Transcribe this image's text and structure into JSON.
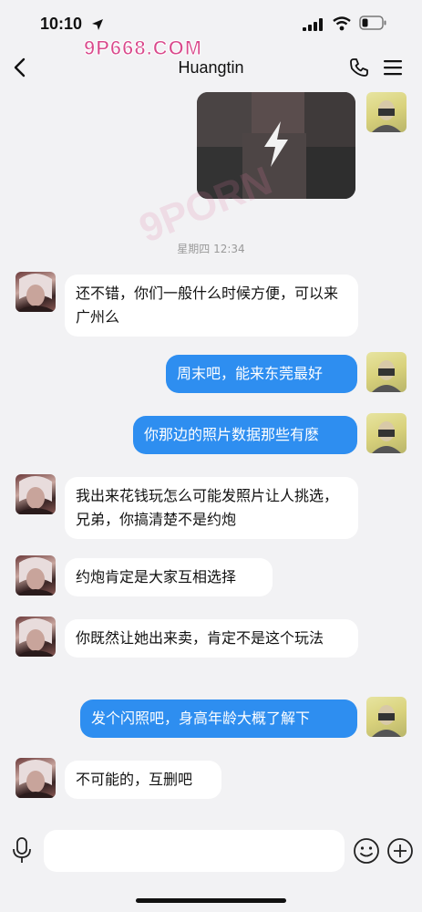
{
  "status": {
    "time": "10:10"
  },
  "watermark": {
    "top_text": "9P668.COM",
    "middle_text": "9PORN"
  },
  "header": {
    "title": "Huangtin"
  },
  "chat": {
    "timestamp": "星期四 12:34",
    "messages": [
      {
        "from": "them",
        "text": "还不错，你们一般什么时候方便，可以来广州么"
      },
      {
        "from": "me",
        "text": "周末吧，能来东莞最好"
      },
      {
        "from": "me",
        "text": "你那边的照片数据那些有麽"
      },
      {
        "from": "them",
        "text": "我出来花钱玩怎么可能发照片让人挑选，兄弟，你搞清楚不是约炮"
      },
      {
        "from": "them",
        "text": "约炮肯定是大家互相选择"
      },
      {
        "from": "them",
        "text": "你既然让她出来卖，肯定不是这个玩法"
      },
      {
        "from": "me",
        "text": "发个闪照吧，身高年龄大概了解下"
      },
      {
        "from": "them",
        "text": "不可能的，互删吧"
      }
    ]
  },
  "input": {
    "placeholder": ""
  },
  "colors": {
    "my_bubble": "#2e8ef0",
    "their_bubble": "#ffffff",
    "background": "#f2f2f4"
  }
}
